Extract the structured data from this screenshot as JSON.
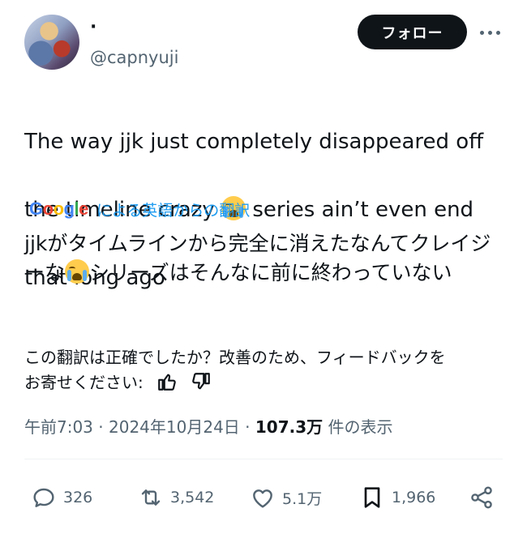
{
  "author": {
    "display_name": "·",
    "handle": "@capnyuji"
  },
  "follow_button": {
    "label": "フォロー"
  },
  "tweet": {
    "line1": "The way jjk just completely disappeared off",
    "line2a": "the timeline crazy ",
    "line2b": " series ain’t even end",
    "line3": "that long ago"
  },
  "translation": {
    "provider_logo": "Google",
    "link_text": "による英語からの翻訳",
    "text_a": "jjkがタイムラインから完全に消えたなんてクレイジーな",
    "text_b": "シリーズはそんなに前に終わっていない"
  },
  "feedback": {
    "text_line1": "この翻訳は正確でしたか？改善のため、フィードバックを",
    "text_line2": "お寄せください: "
  },
  "meta": {
    "time": "午前7:03",
    "separator": " · ",
    "date": "2024年10月24日",
    "views_count": "107.3万",
    "views_label": " 件の表示"
  },
  "actions": {
    "replies": "326",
    "reposts": "3,542",
    "likes": "5.1万",
    "bookmarks": "1,966"
  },
  "icons": [
    "loudly-crying-face-emoji",
    "thumbs-up-icon",
    "thumbs-down-icon",
    "reply-icon",
    "repost-icon",
    "like-icon",
    "bookmark-icon",
    "share-icon",
    "more-icon"
  ]
}
